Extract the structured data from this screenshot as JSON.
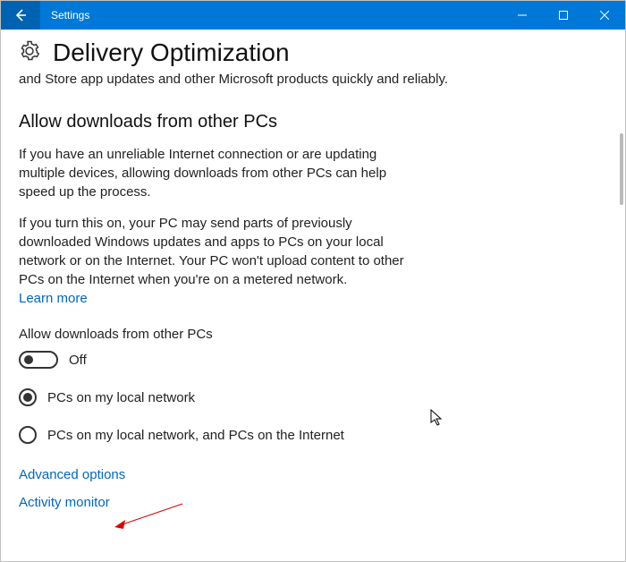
{
  "titlebar": {
    "title": "Settings"
  },
  "header": {
    "pageTitle": "Delivery Optimization",
    "cutoffText": "and Store app updates and other Microsoft products quickly and reliably."
  },
  "section": {
    "heading": "Allow downloads from other PCs",
    "para1": "If you have an unreliable Internet connection or are updating multiple devices, allowing downloads from other PCs can help speed up the process.",
    "para2": "If you turn this on, your PC may send parts of previously downloaded Windows updates and apps to PCs on your local network or on the Internet. Your PC won't upload content to other PCs on the Internet when you're on a metered network.",
    "learnMore": "Learn more"
  },
  "toggle": {
    "label": "Allow downloads from other PCs",
    "state": "Off"
  },
  "radios": {
    "opt1": "PCs on my local network",
    "opt2": "PCs on my local network, and PCs on the Internet"
  },
  "links": {
    "advanced": "Advanced options",
    "activity": "Activity monitor"
  }
}
